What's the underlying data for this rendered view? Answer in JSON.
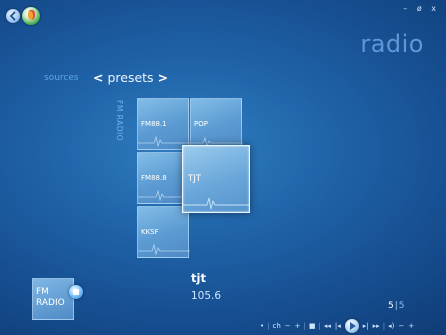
{
  "header": {
    "page_heading": "radio",
    "window_controls": [
      "–",
      "ø",
      "x"
    ]
  },
  "nav": {
    "sources_label": "sources",
    "presets_label": "presets",
    "left_arrow": "<",
    "right_arrow": ">"
  },
  "section_label": "FM RADIO",
  "presets": [
    {
      "label": "FM88.1"
    },
    {
      "label": "POP"
    },
    {
      "label": "FM88.8"
    },
    {
      "label": "TJT"
    },
    {
      "label": "KKSF"
    }
  ],
  "now_playing": {
    "tile_line1": "FM",
    "tile_line2": "RADIO",
    "station": "tjt",
    "frequency": "105.6"
  },
  "counter": {
    "current": "5",
    "separator": "|",
    "total": "5"
  },
  "transport": {
    "glyphs": {
      "dot": "•",
      "ch": "ch",
      "minus": "−",
      "plus": "+",
      "stop": "■",
      "rewind": "◂◂",
      "prev": "|◂",
      "next": "▸|",
      "ffwd": "▸▸",
      "volume": "◂)",
      "vol_minus": "−",
      "vol_plus": "+",
      "divider": "|"
    }
  },
  "colors": {
    "background": "#1f62a8",
    "accent": "#5aa4ec",
    "tile": "#5b9bd2",
    "heading": "#5f98d4"
  }
}
